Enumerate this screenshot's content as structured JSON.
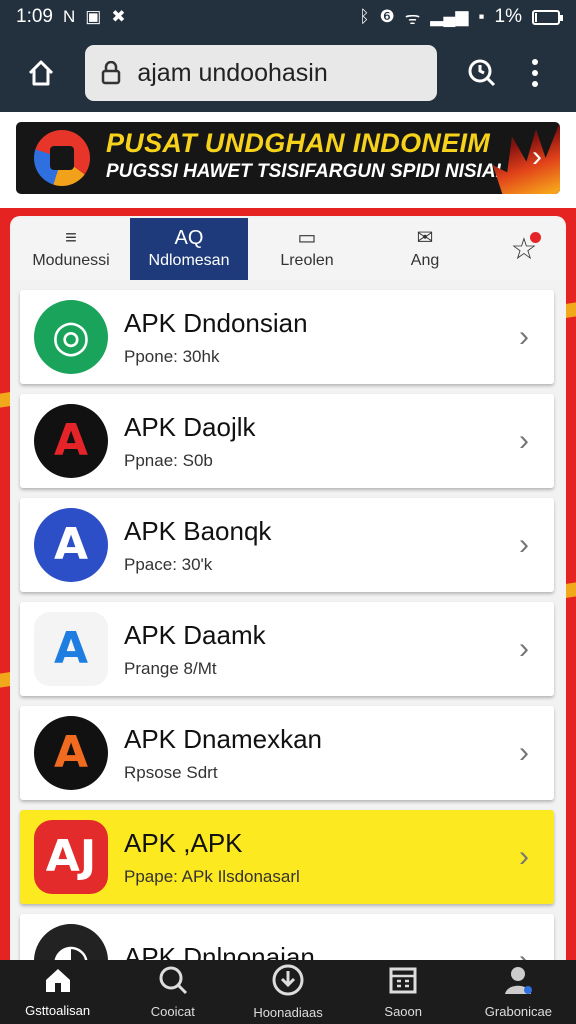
{
  "status_bar": {
    "time": "1:09",
    "left_glyphs": [
      "N"
    ],
    "battery_percent": "1%",
    "battery_level": 0.1
  },
  "browser": {
    "url": "ajam undoohasin"
  },
  "banner": {
    "title": "PUSAT UNDGHAN INDONEIM",
    "subtitle": "PUGSSI HAWET TSISIFARGUN SPIDI NISIAI"
  },
  "tabs": [
    {
      "label": "Modunessi",
      "glyph": "≡",
      "active": false
    },
    {
      "label": "Ndlomesan",
      "glyph": "AQ",
      "active": true
    },
    {
      "label": "Lreolen",
      "glyph": "▭",
      "active": false
    },
    {
      "label": "Ang",
      "glyph": "✉",
      "active": false
    }
  ],
  "apps": [
    {
      "name": "APK Dndonsian",
      "size": "Ppone: 30hk",
      "icon": "whatsapp-style-icon",
      "bg": "#1aa35a",
      "fg": "#ffffff",
      "glyph": "◎",
      "highlight": false
    },
    {
      "name": "APK Daojlk",
      "size": "Ppnae: S0b",
      "icon": "letter-a-red-icon",
      "bg": "#111111",
      "fg": "#e5242a",
      "glyph": "A",
      "highlight": false
    },
    {
      "name": "APK Baonqk",
      "size": "Ppace: 30'k",
      "icon": "letter-a-blue-icon",
      "bg": "#2c4fc7",
      "fg": "#ffffff",
      "glyph": "A",
      "highlight": false
    },
    {
      "name": "APK Daamk",
      "size": "Prange 8/Mt",
      "icon": "letter-a-gradient-icon",
      "bg": "#f4f4f4",
      "fg": "#1e7de0",
      "glyph": "A",
      "highlight": false
    },
    {
      "name": "APK Dnamexkan",
      "size": "Rpsose Sdrt",
      "icon": "letter-a-orange-icon",
      "bg": "#111111",
      "fg": "#f06a1f",
      "glyph": "A",
      "highlight": false
    },
    {
      "name": "APK ,APK",
      "size": "Ppape: APk Ilsdonasarl",
      "icon": "aj-logo-icon",
      "bg": "#e32b2b",
      "fg": "#ffffff",
      "glyph": "AJ",
      "highlight": true
    },
    {
      "name": "APK Dnlnonaian",
      "size": "",
      "icon": "partial-app-icon",
      "bg": "#222222",
      "fg": "#ffffff",
      "glyph": "◐",
      "highlight": false
    }
  ],
  "bottom_nav": [
    {
      "label": "Gsttoalisan",
      "icon": "home-icon",
      "active": true
    },
    {
      "label": "Cooicat",
      "icon": "search-icon",
      "active": false
    },
    {
      "label": "Hoonadiaas",
      "icon": "download-circle-icon",
      "active": false
    },
    {
      "label": "Saoon",
      "icon": "calendar-icon",
      "active": false
    },
    {
      "label": "Grabonicae",
      "icon": "user-icon",
      "active": false
    }
  ],
  "colors": {
    "top_bar": "#23303d",
    "accent_red": "#e52421",
    "tab_active": "#1e3a7a",
    "highlight_yellow": "#fde91f",
    "nav_bg": "#1c1c1c"
  }
}
